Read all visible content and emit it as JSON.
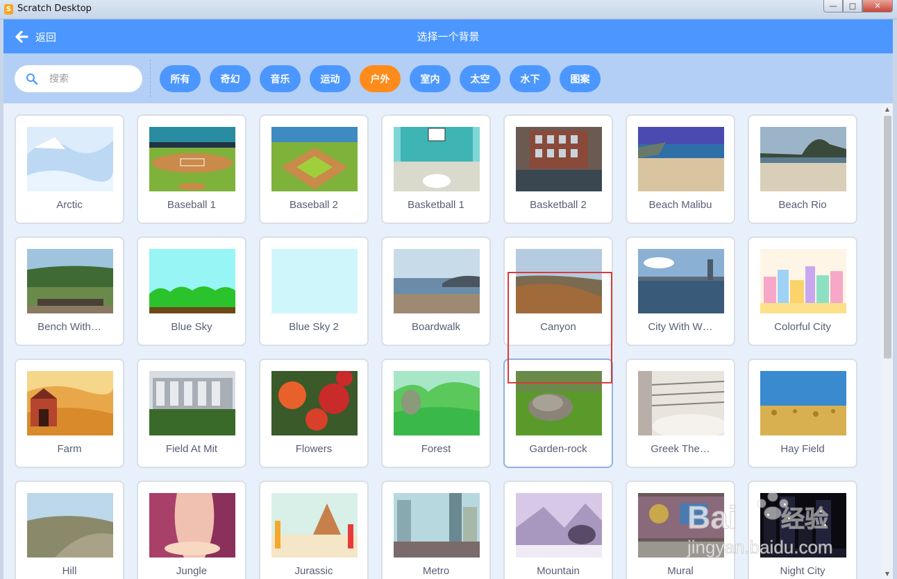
{
  "window": {
    "title": "Scratch Desktop"
  },
  "header": {
    "back_label": "返回",
    "title": "选择一个背景"
  },
  "search": {
    "placeholder": "搜索",
    "value": ""
  },
  "tags": [
    {
      "label": "所有",
      "active": false
    },
    {
      "label": "奇幻",
      "active": false
    },
    {
      "label": "音乐",
      "active": false
    },
    {
      "label": "运动",
      "active": false
    },
    {
      "label": "户外",
      "active": true
    },
    {
      "label": "室内",
      "active": false
    },
    {
      "label": "太空",
      "active": false
    },
    {
      "label": "水下",
      "active": false
    },
    {
      "label": "图案",
      "active": false
    }
  ],
  "colors": {
    "header": "#4c97ff",
    "active_tag": "#ff8c1a",
    "filterbar": "#b3cff5",
    "highlight": "#d93a3a"
  },
  "backdrops": [
    {
      "name": "Arctic"
    },
    {
      "name": "Baseball 1"
    },
    {
      "name": "Baseball 2"
    },
    {
      "name": "Basketball 1"
    },
    {
      "name": "Basketball 2"
    },
    {
      "name": "Beach Malibu"
    },
    {
      "name": "Beach Rio"
    },
    {
      "name": "Bench With…"
    },
    {
      "name": "Blue Sky"
    },
    {
      "name": "Blue Sky 2"
    },
    {
      "name": "Boardwalk"
    },
    {
      "name": "Canyon"
    },
    {
      "name": "City With W…"
    },
    {
      "name": "Colorful City"
    },
    {
      "name": "Farm"
    },
    {
      "name": "Field At Mit"
    },
    {
      "name": "Flowers"
    },
    {
      "name": "Forest"
    },
    {
      "name": "Garden-rock",
      "selected": true
    },
    {
      "name": "Greek The…"
    },
    {
      "name": "Hay Field"
    },
    {
      "name": "Hill"
    },
    {
      "name": "Jungle"
    },
    {
      "name": "Jurassic"
    },
    {
      "name": "Metro"
    },
    {
      "name": "Mountain"
    },
    {
      "name": "Mural"
    },
    {
      "name": "Night City"
    }
  ],
  "watermark": {
    "text1": "Bai",
    "text2": "经验",
    "url": "jingyan.baidu.com"
  }
}
